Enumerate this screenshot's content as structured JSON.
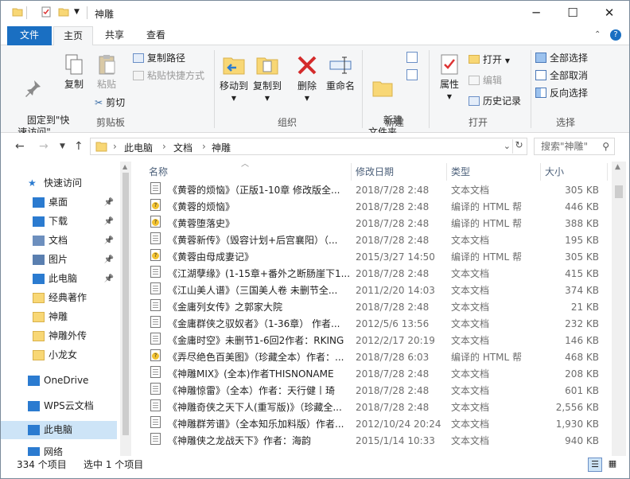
{
  "window": {
    "title": "神雕"
  },
  "tabs": [
    "文件",
    "主页",
    "共享",
    "查看"
  ],
  "ribbon": {
    "pin_label": "固定到\"快\n速访问\"",
    "copy": "复制",
    "paste": "粘贴",
    "copy_path": "复制路径",
    "paste_shortcut": "粘贴快捷方式",
    "cut": "剪切",
    "move_to": "移动到",
    "copy_to": "复制到",
    "delete": "删除",
    "rename": "重命名",
    "new_folder": "新建\n文件夹",
    "properties": "属性",
    "open": "打开",
    "edit": "编辑",
    "history": "历史记录",
    "select_all": "全部选择",
    "select_none": "全部取消",
    "invert": "反向选择",
    "groups": {
      "clipboard": "剪贴板",
      "organize": "组织",
      "new": "新建",
      "open": "打开",
      "select": "选择"
    }
  },
  "nav": {
    "breadcrumb": [
      "此电脑",
      "文档",
      "神雕"
    ],
    "search_placeholder": "搜索\"神雕\""
  },
  "sidebar": [
    {
      "label": "快速访问",
      "icon": "star-icon"
    },
    {
      "label": "桌面",
      "icon": "desktop-icon",
      "pinned": true
    },
    {
      "label": "下载",
      "icon": "download-icon",
      "pinned": true
    },
    {
      "label": "文档",
      "icon": "document-icon",
      "pinned": true
    },
    {
      "label": "图片",
      "icon": "picture-icon",
      "pinned": true
    },
    {
      "label": "此电脑",
      "icon": "computer-icon",
      "pinned": true
    },
    {
      "label": "经典著作",
      "icon": "folder-icon"
    },
    {
      "label": "神雕",
      "icon": "folder-icon"
    },
    {
      "label": "神雕外传",
      "icon": "folder-icon"
    },
    {
      "label": "小龙女",
      "icon": "folder-icon"
    },
    {
      "label": "OneDrive",
      "icon": "cloud-icon"
    },
    {
      "label": "WPS云文档",
      "icon": "wps-cloud-icon"
    },
    {
      "label": "此电脑",
      "icon": "computer-icon"
    },
    {
      "label": "网络",
      "icon": "network-icon"
    }
  ],
  "columns": [
    "名称",
    "修改日期",
    "类型",
    "大小"
  ],
  "files": [
    {
      "name": "《黄蓉的烦恼》（正版1-10章 修改版全...",
      "date": "2018/7/28 2:48",
      "type": "文本文档",
      "size": "305 KB",
      "kind": "txt"
    },
    {
      "name": "《黄蓉的烦恼》",
      "date": "2018/7/28 2:48",
      "type": "编译的 HTML 帮",
      "size": "446 KB",
      "kind": "chm"
    },
    {
      "name": "《黄蓉堕落史》",
      "date": "2018/7/28 2:48",
      "type": "编译的 HTML 帮",
      "size": "388 KB",
      "kind": "chm"
    },
    {
      "name": "《黄蓉新传》（毁容计划+后宫襄阳）（...",
      "date": "2018/7/28 2:48",
      "type": "文本文档",
      "size": "195 KB",
      "kind": "txt"
    },
    {
      "name": "《黄蓉由母成妻记》",
      "date": "2015/3/27 14:50",
      "type": "编译的 HTML 帮",
      "size": "305 KB",
      "kind": "chm"
    },
    {
      "name": "《江湖孽缘》(1-15章+番外之断肠崖下1...",
      "date": "2018/7/28 2:48",
      "type": "文本文档",
      "size": "415 KB",
      "kind": "txt"
    },
    {
      "name": "《江山美人谱》（三国美人卷 未删节全...",
      "date": "2011/2/20 14:03",
      "type": "文本文档",
      "size": "374 KB",
      "kind": "txt"
    },
    {
      "name": "《金庸列女传》之郭家大院",
      "date": "2018/7/28 2:48",
      "type": "文本文档",
      "size": "21 KB",
      "kind": "txt"
    },
    {
      "name": "《金庸群侠之驭奴者》（1-36章） 作者...",
      "date": "2012/5/6 13:56",
      "type": "文本文档",
      "size": "232 KB",
      "kind": "txt"
    },
    {
      "name": "《金庸时空》未删节1-6回2作者：RKING",
      "date": "2012/2/17 20:19",
      "type": "文本文档",
      "size": "146 KB",
      "kind": "txt"
    },
    {
      "name": "《弄尽绝色百美图》（珍藏全本）作者：...",
      "date": "2018/7/28 6:03",
      "type": "编译的 HTML 帮",
      "size": "468 KB",
      "kind": "chm"
    },
    {
      "name": "《神雕MIX》(全本)作者THISNONAME",
      "date": "2018/7/28 2:48",
      "type": "文本文档",
      "size": "208 KB",
      "kind": "txt"
    },
    {
      "name": "《神雕惊雷》（全本）作者：天行健丨琦",
      "date": "2018/7/28 2:48",
      "type": "文本文档",
      "size": "601 KB",
      "kind": "txt"
    },
    {
      "name": "《神雕奇侠之天下人(重写版)》（珍藏全...",
      "date": "2018/7/28 2:48",
      "type": "文本文档",
      "size": "2,556 KB",
      "kind": "txt"
    },
    {
      "name": "《神雕群芳谱》（全本知乐加料版）作者...",
      "date": "2012/10/24 20:24",
      "type": "文本文档",
      "size": "1,930 KB",
      "kind": "txt"
    },
    {
      "name": "《神雕侠之龙战天下》作者：海韵",
      "date": "2015/1/14 10:33",
      "type": "文本文档",
      "size": "940 KB",
      "kind": "txt"
    }
  ],
  "status": {
    "count": "334 个项目",
    "selected": "选中 1 个项目"
  }
}
